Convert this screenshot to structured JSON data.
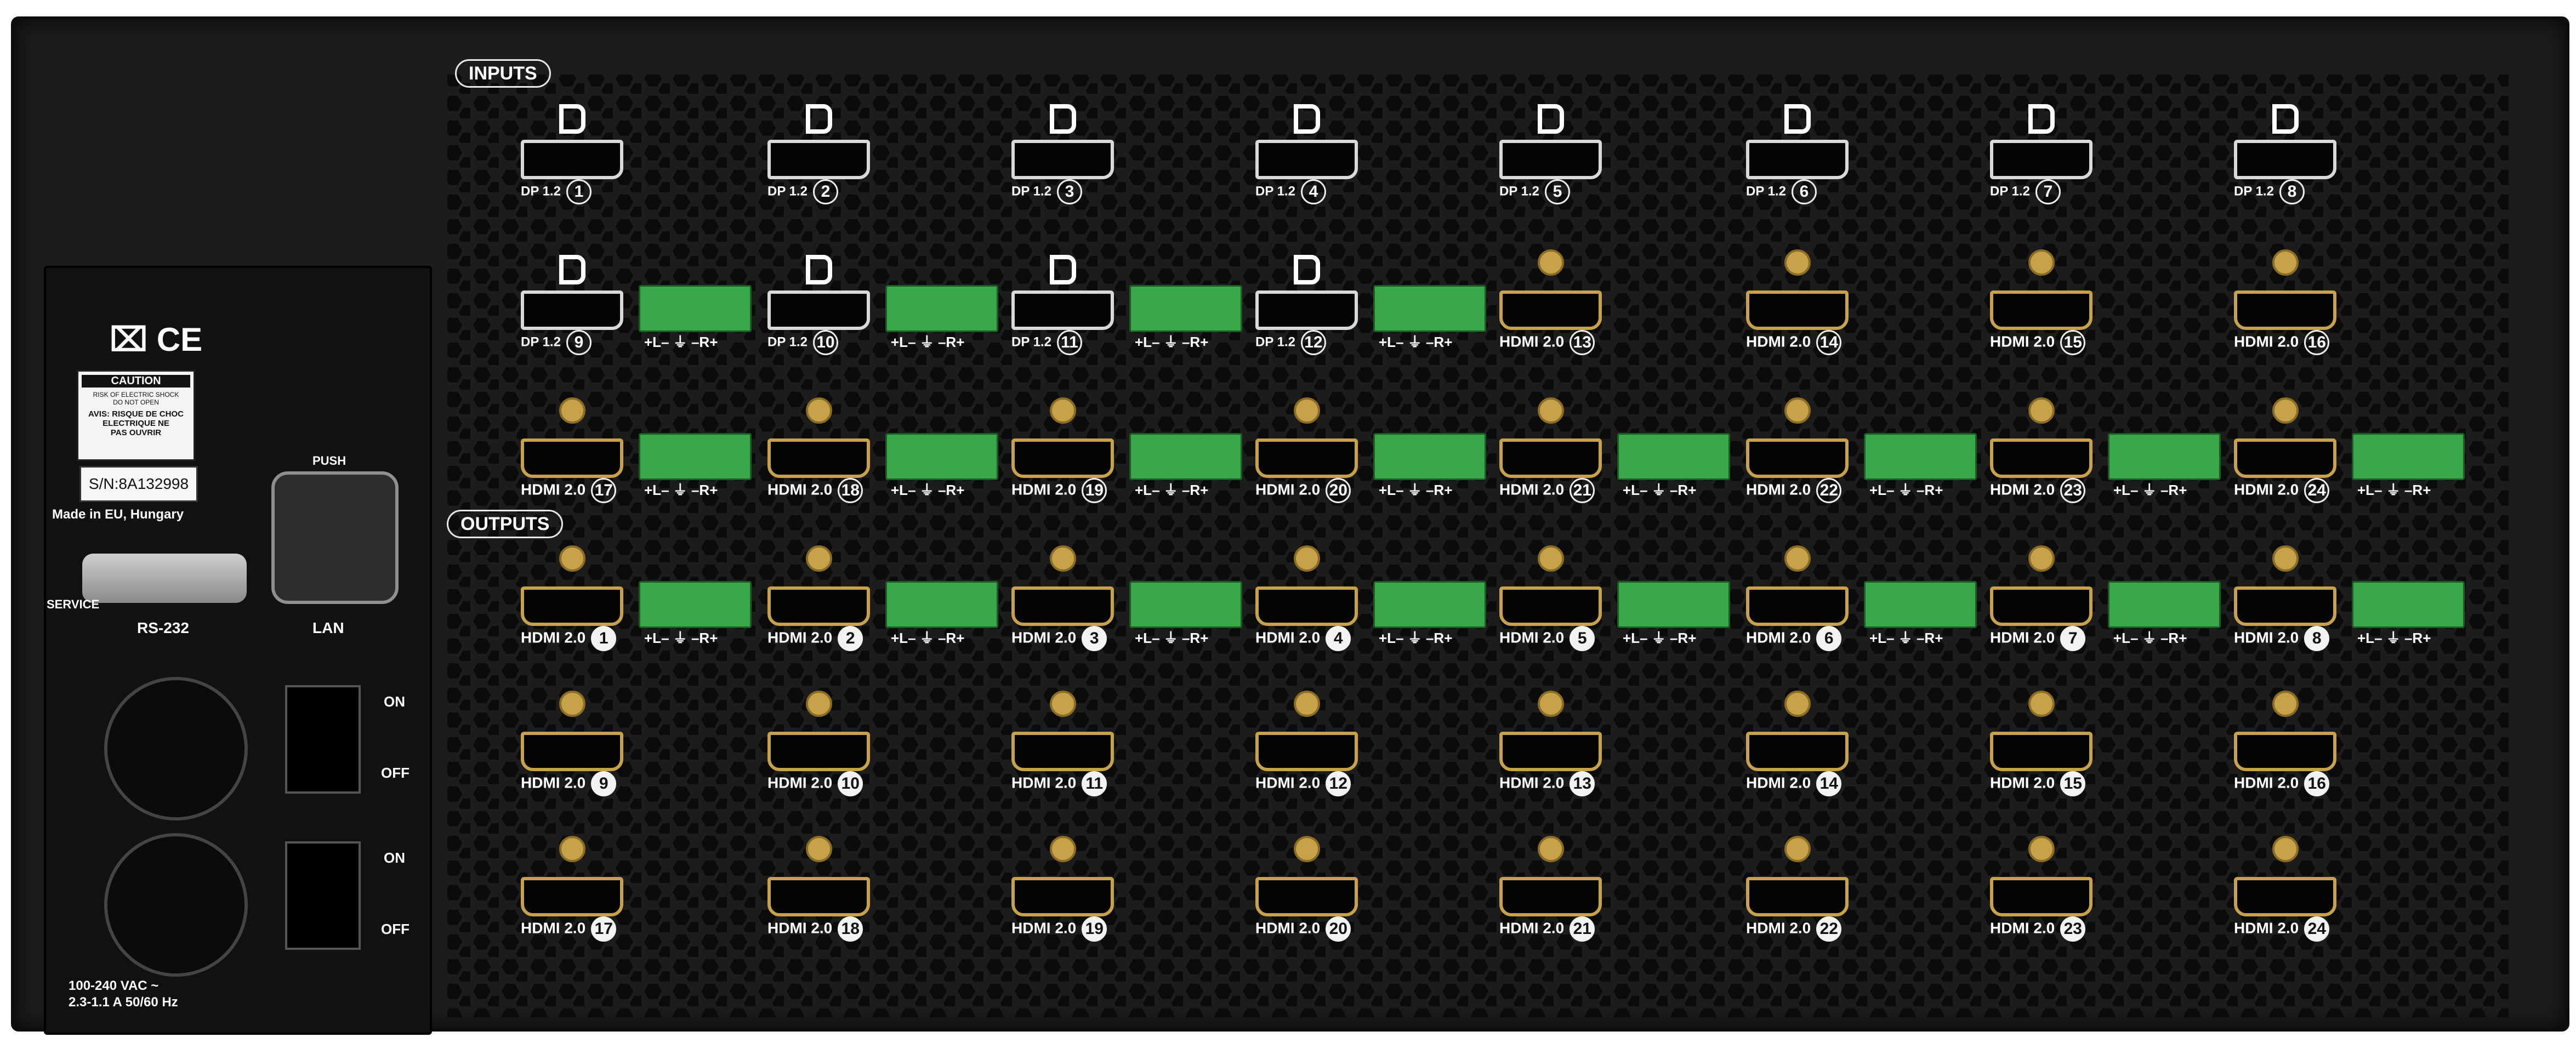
{
  "panel": {
    "inputs_label": "INPUTS",
    "outputs_label": "OUTPUTS",
    "dp_label": "DP 1.2",
    "hdmi_label": "HDMI 2.0",
    "audio_label": "+L– ⏚ –R+",
    "port_fill": "#c8a24a",
    "terminal_color": "#39a84a",
    "dp_inputs": [
      "1",
      "2",
      "3",
      "4",
      "5",
      "6",
      "7",
      "8",
      "9",
      "10",
      "11",
      "12"
    ],
    "hdmi_inputs": [
      "13",
      "14",
      "15",
      "16",
      "17",
      "18",
      "19",
      "20",
      "21",
      "22",
      "23",
      "24"
    ],
    "outputs": [
      "1",
      "2",
      "3",
      "4",
      "5",
      "6",
      "7",
      "8",
      "9",
      "10",
      "11",
      "12",
      "13",
      "14",
      "15",
      "16",
      "17",
      "18",
      "19",
      "20",
      "21",
      "22",
      "23",
      "24"
    ]
  },
  "side": {
    "caution_title": "CAUTION",
    "caution_line1": "RISK OF ELECTRIC SHOCK",
    "caution_line2": "DO NOT OPEN",
    "avis_line1": "AVIS: RISQUE DE CHOC",
    "avis_line2": "ELECTRIQUE NE",
    "avis_line3": "PAS OUVRIR",
    "serial": "S/N:8A132998",
    "made_in": "Made in EU, Hungary",
    "push_label": "PUSH",
    "service_label": "SERVICE",
    "rs232_label": "RS-232",
    "lan_label": "LAN",
    "on_label": "ON",
    "off_label": "OFF",
    "power_line1": "100-240 VAC ~",
    "power_line2": "2.3-1.1 A 50/60 Hz"
  }
}
